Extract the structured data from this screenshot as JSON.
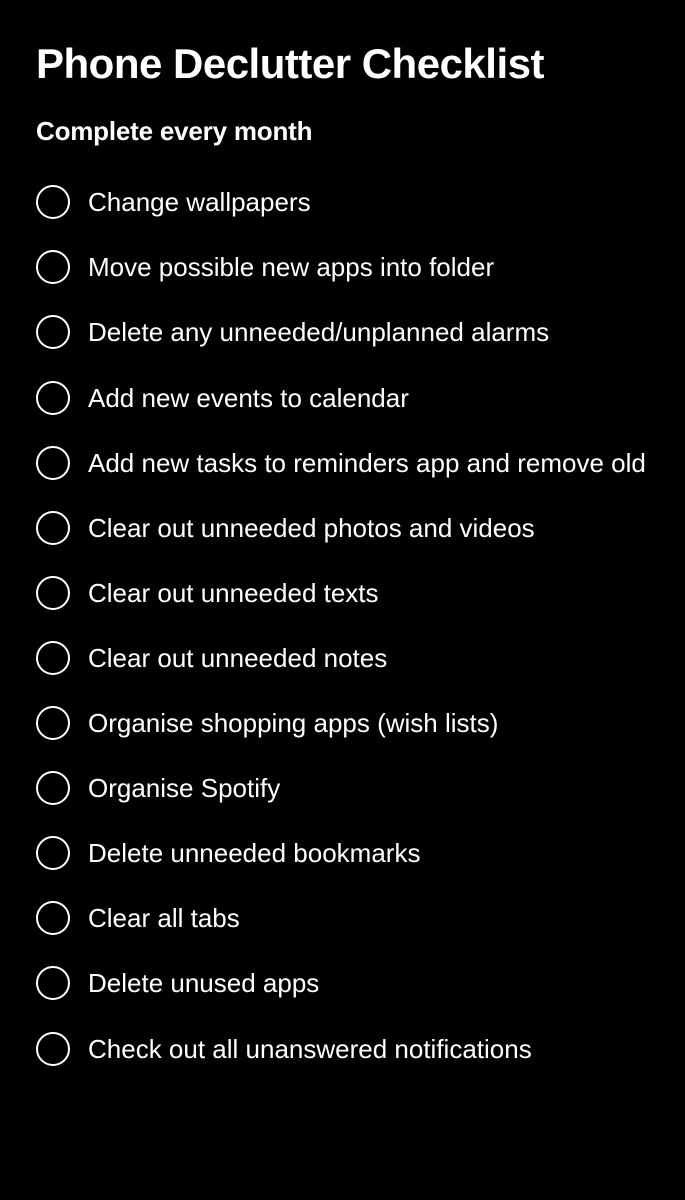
{
  "title": "Phone Declutter Checklist",
  "section": {
    "heading": "Complete every month",
    "items": [
      {
        "id": "change-wallpapers",
        "label": "Change wallpapers"
      },
      {
        "id": "move-apps-folder",
        "label": "Move possible new apps into folder"
      },
      {
        "id": "delete-alarms",
        "label": "Delete any unneeded/unplanned alarms"
      },
      {
        "id": "add-calendar-events",
        "label": "Add new events to calendar"
      },
      {
        "id": "add-reminders",
        "label": "Add new tasks to reminders app and remove old"
      },
      {
        "id": "clear-photos-videos",
        "label": "Clear out unneeded photos and videos"
      },
      {
        "id": "clear-texts",
        "label": "Clear out unneeded texts"
      },
      {
        "id": "clear-notes",
        "label": "Clear out unneeded notes"
      },
      {
        "id": "organise-shopping",
        "label": "Organise shopping apps (wish lists)"
      },
      {
        "id": "organise-spotify",
        "label": "Organise Spotify"
      },
      {
        "id": "delete-bookmarks",
        "label": "Delete unneeded bookmarks"
      },
      {
        "id": "clear-tabs",
        "label": "Clear all tabs"
      },
      {
        "id": "delete-unused-apps",
        "label": "Delete unused apps"
      },
      {
        "id": "check-notifications",
        "label": "Check out all unanswered notifications"
      }
    ]
  }
}
